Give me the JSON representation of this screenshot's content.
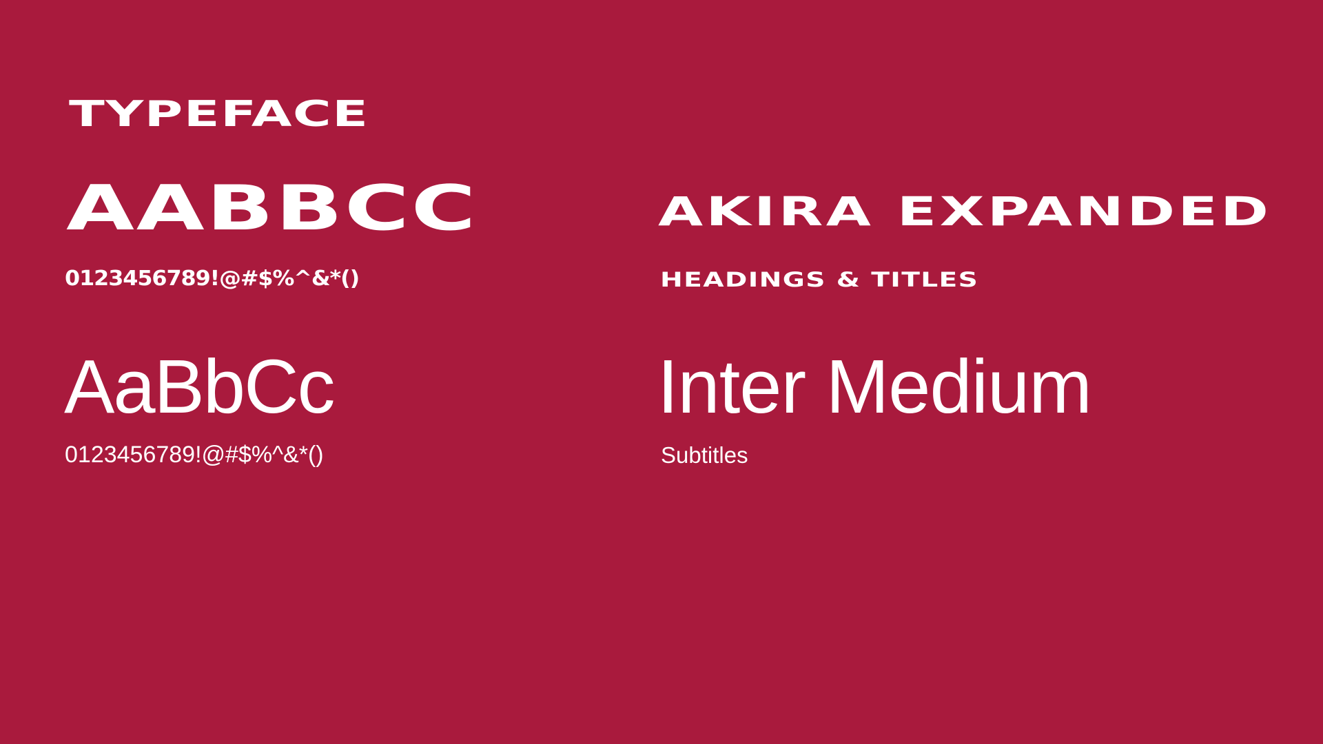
{
  "slide": {
    "heading": "TYPEFACE",
    "background_color": "#A91A3D",
    "text_color": "#FFFFFF"
  },
  "primary_typeface": {
    "sample": "AABBCC",
    "numerals": "0123456789!@#$%^&*()",
    "name": "AKIRA EXPANDED",
    "usage": "HEADINGS & TITLES"
  },
  "secondary_typeface": {
    "sample": "AaBbCc",
    "numerals": "0123456789!@#$%^&*()",
    "name": "Inter Medium",
    "usage": "Subtitles"
  }
}
